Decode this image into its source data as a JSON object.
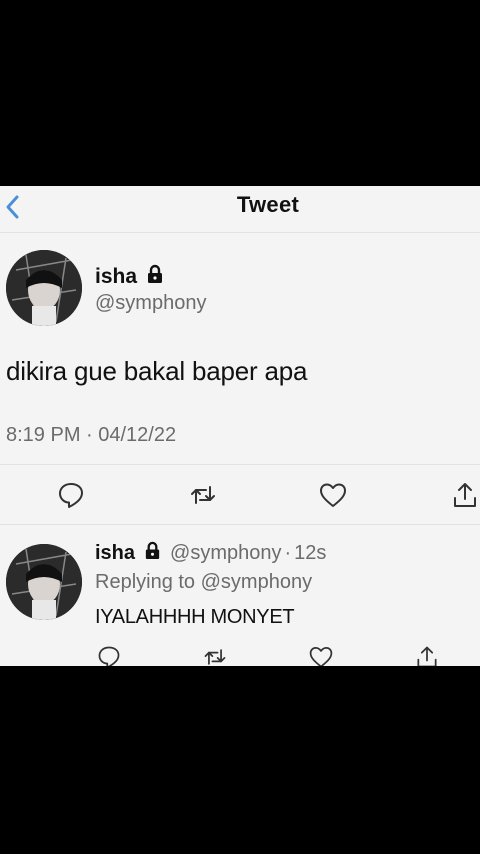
{
  "nav": {
    "title": "Tweet"
  },
  "tweet": {
    "name": "isha",
    "handle": "@symphony",
    "text": "dikira gue bakal baper apa",
    "timestamp": "8:19 PM · 04/12/22"
  },
  "reply": {
    "name": "isha",
    "handle": "@symphony",
    "separator": "·",
    "time": "12s",
    "replying_prefix": "Replying to",
    "replying_to": "@symphony",
    "text": "IYALAHHHH MONYET"
  },
  "icons": {
    "back": "chevron-left-icon",
    "lock": "lock-icon",
    "reply": "comment-icon",
    "retweet": "retweet-icon",
    "like": "heart-icon",
    "share": "share-icon"
  },
  "colors": {
    "accent": "#4a90d9",
    "text": "#111111",
    "secondary": "#6b6b6b"
  }
}
